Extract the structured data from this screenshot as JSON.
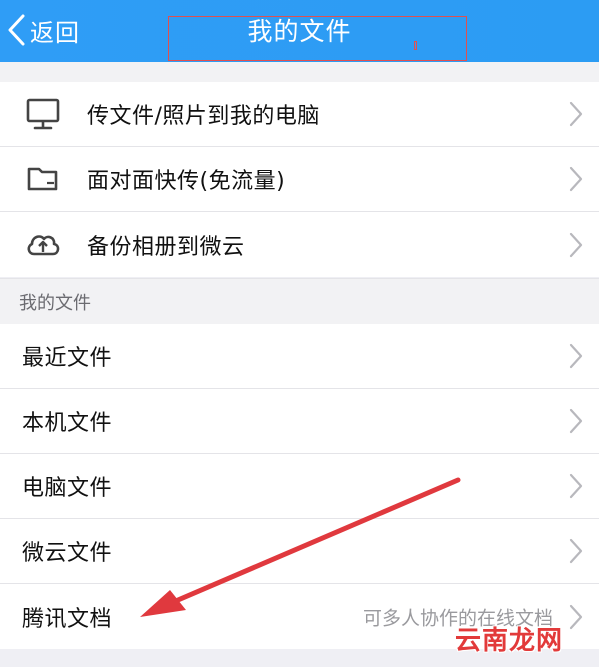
{
  "navbar": {
    "back_label": "返回",
    "title": "我的文件",
    "background": "#2f9df6"
  },
  "tools": [
    {
      "label": "传文件/照片到我的电脑",
      "icon": "monitor-icon"
    },
    {
      "label": "面对面快传(免流量)",
      "icon": "folder-icon"
    },
    {
      "label": "备份相册到微云",
      "icon": "cloud-upload-icon"
    }
  ],
  "section": {
    "header": "我的文件"
  },
  "files": [
    {
      "label": "最近文件",
      "hint": ""
    },
    {
      "label": "本机文件",
      "hint": ""
    },
    {
      "label": "电脑文件",
      "hint": ""
    },
    {
      "label": "微云文件",
      "hint": ""
    },
    {
      "label": "腾讯文档",
      "hint": "可多人协作的在线文档"
    }
  ],
  "annotation": {
    "color": "#e0393e"
  },
  "watermark": {
    "text": "云南龙网"
  }
}
